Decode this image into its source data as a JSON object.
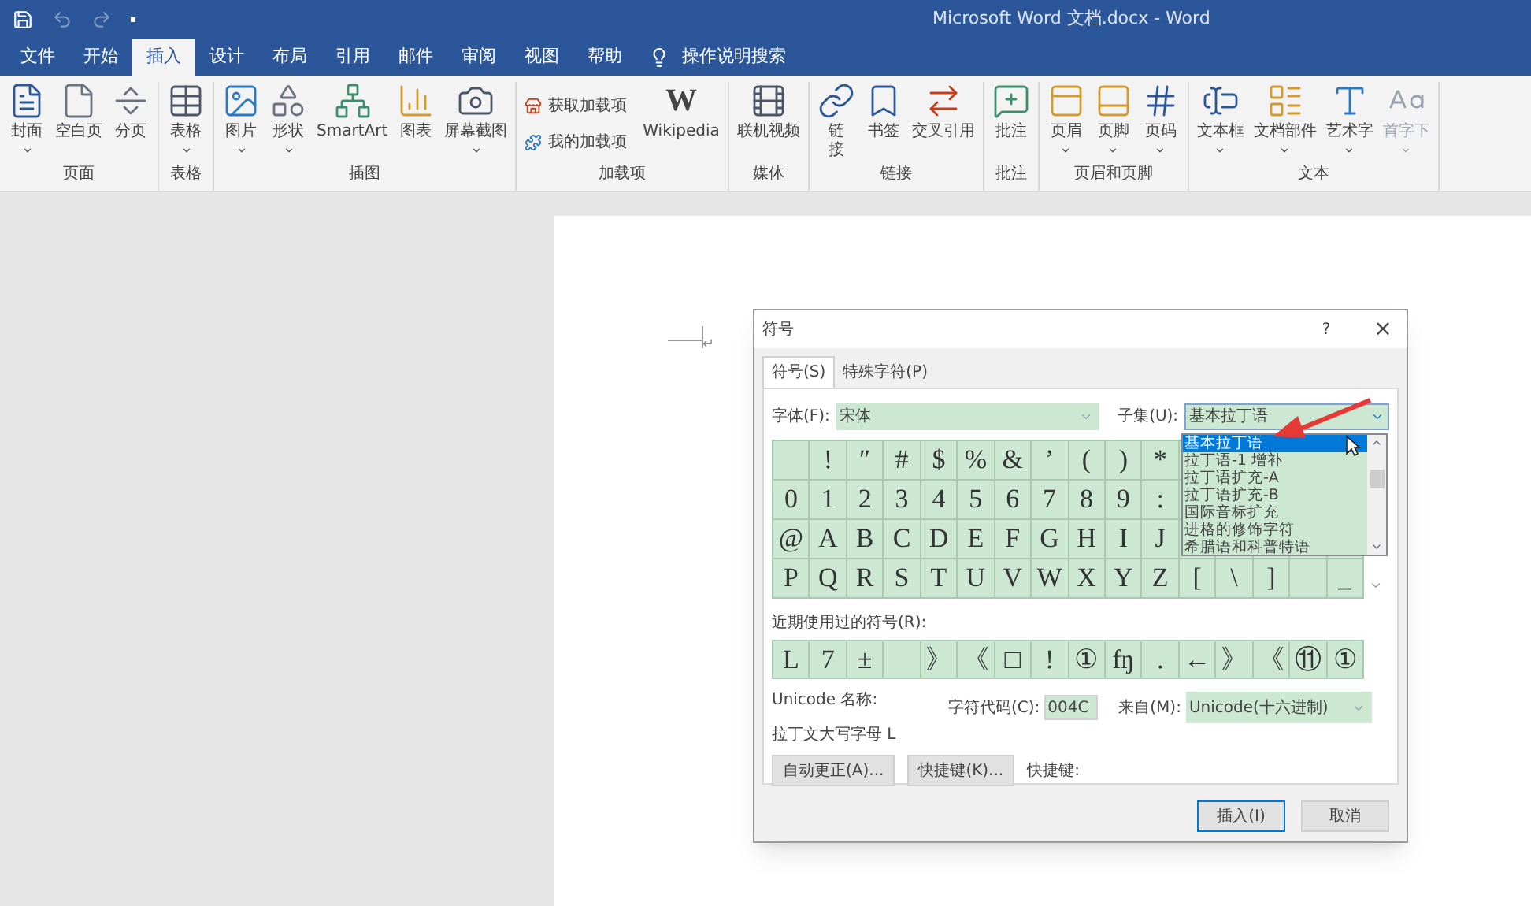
{
  "window": {
    "title": "Microsoft Word 文档.docx  -  Word"
  },
  "ribbon_tabs": [
    {
      "label": "文件",
      "selected": false
    },
    {
      "label": "开始",
      "selected": false
    },
    {
      "label": "插入",
      "selected": true
    },
    {
      "label": "设计",
      "selected": false
    },
    {
      "label": "布局",
      "selected": false
    },
    {
      "label": "引用",
      "selected": false
    },
    {
      "label": "邮件",
      "selected": false
    },
    {
      "label": "审阅",
      "selected": false
    },
    {
      "label": "视图",
      "selected": false
    },
    {
      "label": "帮助",
      "selected": false
    }
  ],
  "tell_me": {
    "label": "操作说明搜索"
  },
  "ribbon_groups": [
    {
      "label": "页面",
      "items": [
        {
          "label": "封面",
          "has_menu": true
        },
        {
          "label": "空白页",
          "has_menu": false
        },
        {
          "label": "分页",
          "has_menu": false
        }
      ]
    },
    {
      "label": "表格",
      "items": [
        {
          "label": "表格",
          "has_menu": true
        }
      ]
    },
    {
      "label": "插图",
      "items": [
        {
          "label": "图片",
          "has_menu": true
        },
        {
          "label": "形状",
          "has_menu": true
        },
        {
          "label": "SmartArt",
          "has_menu": false
        },
        {
          "label": "图表",
          "has_menu": false
        },
        {
          "label": "屏幕截图",
          "has_menu": true
        }
      ]
    },
    {
      "label": "加载项",
      "kind": "addins",
      "small_items": [
        {
          "label": "获取加载项"
        },
        {
          "label": "我的加载项"
        }
      ],
      "items": [
        {
          "label": "Wikipedia",
          "has_menu": false,
          "icon_text": "W"
        }
      ]
    },
    {
      "label": "媒体",
      "items": [
        {
          "label": "联机视频",
          "has_menu": false
        }
      ]
    },
    {
      "label": "链接",
      "items": [
        {
          "label": "链接",
          "has_menu": false
        },
        {
          "label": "书签",
          "has_menu": false
        },
        {
          "label": "交叉引用",
          "has_menu": false
        }
      ]
    },
    {
      "label": "批注",
      "items": [
        {
          "label": "批注",
          "has_menu": false
        }
      ]
    },
    {
      "label": "页眉和页脚",
      "items": [
        {
          "label": "页眉",
          "has_menu": true
        },
        {
          "label": "页脚",
          "has_menu": true
        },
        {
          "label": "页码",
          "has_menu": true
        }
      ]
    },
    {
      "label": "文本",
      "items": [
        {
          "label": "文本框",
          "has_menu": true
        },
        {
          "label": "文档部件",
          "has_menu": true
        },
        {
          "label": "艺术字",
          "has_menu": true
        },
        {
          "label": "首字下",
          "has_menu": true
        }
      ]
    }
  ],
  "document": {
    "paragraph_mark": "↵"
  },
  "dialog": {
    "title": "符号",
    "help": "?",
    "close": "×",
    "tabs": [
      {
        "label": "符号(S)",
        "selected": true
      },
      {
        "label": "特殊字符(P)",
        "selected": false
      }
    ],
    "font": {
      "label": "字体(F):",
      "value": "宋体"
    },
    "subset": {
      "label": "子集(U):",
      "value": "基本拉丁语"
    },
    "symbol_rows": [
      [
        {
          "kind": "blank"
        },
        {
          "kind": "symbol",
          "char": "!"
        },
        {
          "kind": "symbol",
          "char": "″"
        },
        {
          "kind": "symbol",
          "char": "#"
        },
        {
          "kind": "symbol",
          "char": "$"
        },
        {
          "kind": "symbol",
          "char": "%"
        },
        {
          "kind": "symbol",
          "char": "&"
        },
        {
          "kind": "symbol",
          "char": "’"
        },
        {
          "kind": "symbol",
          "char": "("
        },
        {
          "kind": "symbol",
          "char": ")"
        },
        {
          "kind": "symbol",
          "char": "*"
        }
      ],
      [
        {
          "kind": "symbol",
          "char": "0"
        },
        {
          "kind": "symbol",
          "char": "1"
        },
        {
          "kind": "symbol",
          "char": "2"
        },
        {
          "kind": "symbol",
          "char": "3"
        },
        {
          "kind": "symbol",
          "char": "4"
        },
        {
          "kind": "symbol",
          "char": "5"
        },
        {
          "kind": "symbol",
          "char": "6"
        },
        {
          "kind": "symbol",
          "char": "7"
        },
        {
          "kind": "symbol",
          "char": "8"
        },
        {
          "kind": "symbol",
          "char": "9"
        },
        {
          "kind": "symbol",
          "char": ":"
        }
      ],
      [
        {
          "kind": "symbol",
          "char": "@"
        },
        {
          "kind": "symbol",
          "char": "A"
        },
        {
          "kind": "symbol",
          "char": "B"
        },
        {
          "kind": "symbol",
          "char": "C"
        },
        {
          "kind": "symbol",
          "char": "D"
        },
        {
          "kind": "symbol",
          "char": "E"
        },
        {
          "kind": "symbol",
          "char": "F"
        },
        {
          "kind": "symbol",
          "char": "G"
        },
        {
          "kind": "symbol",
          "char": "H"
        },
        {
          "kind": "symbol",
          "char": "I"
        },
        {
          "kind": "symbol",
          "char": "J"
        }
      ],
      [
        {
          "kind": "symbol",
          "char": "P"
        },
        {
          "kind": "symbol",
          "char": "Q"
        },
        {
          "kind": "symbol",
          "char": "R"
        },
        {
          "kind": "symbol",
          "char": "S"
        },
        {
          "kind": "symbol",
          "char": "T"
        },
        {
          "kind": "symbol",
          "char": "U"
        },
        {
          "kind": "symbol",
          "char": "V"
        },
        {
          "kind": "symbol",
          "char": "W"
        },
        {
          "kind": "symbol",
          "char": "X"
        },
        {
          "kind": "symbol",
          "char": "Y"
        },
        {
          "kind": "symbol",
          "char": "Z"
        },
        {
          "kind": "symbol",
          "char": "["
        },
        {
          "kind": "symbol",
          "char": "\\"
        },
        {
          "kind": "symbol",
          "char": "]"
        },
        {
          "kind": "blank"
        },
        {
          "kind": "symbol",
          "char": "_"
        }
      ]
    ],
    "subset_options": [
      {
        "label": "基本拉丁语",
        "selected": true
      },
      {
        "label": "拉丁语-1 增补",
        "selected": false
      },
      {
        "label": "拉丁语扩充-A",
        "selected": false
      },
      {
        "label": "拉丁语扩充-B",
        "selected": false
      },
      {
        "label": "国际音标扩充",
        "selected": false
      },
      {
        "label": "进格的修饰字符",
        "selected": false
      },
      {
        "label": "希腊语和科普特语",
        "selected": false
      }
    ],
    "recent_label": "近期使用过的符号(R):",
    "recent": [
      {
        "kind": "symbol",
        "char": "L"
      },
      {
        "kind": "symbol",
        "char": "7"
      },
      {
        "kind": "symbol",
        "char": "±"
      },
      {
        "kind": "blank"
      },
      {
        "kind": "symbol",
        "char": "》"
      },
      {
        "kind": "symbol",
        "char": "《"
      },
      {
        "kind": "symbol",
        "char": "□"
      },
      {
        "kind": "symbol",
        "char": "!"
      },
      {
        "kind": "symbol",
        "char": "①"
      },
      {
        "kind": "symbol",
        "char": "fŋ"
      },
      {
        "kind": "symbol",
        "char": "."
      },
      {
        "kind": "symbol",
        "char": "←"
      },
      {
        "kind": "symbol",
        "char": "》"
      },
      {
        "kind": "symbol",
        "char": "《"
      },
      {
        "kind": "symbol",
        "char": "⑪"
      },
      {
        "kind": "symbol",
        "char": "①"
      }
    ],
    "unicode_name_label": "Unicode 名称:",
    "unicode_name": "拉丁文大写字母 L",
    "char_code": {
      "label": "字符代码(C):",
      "value": "004C"
    },
    "from": {
      "label": "来自(M):",
      "value": "Unicode(十六进制)"
    },
    "autocorrect_button": "自动更正(A)...",
    "shortcut_button": "快捷键(K)...",
    "shortcut_label": "快捷键:",
    "buttons": [
      {
        "label": "插入(I)",
        "selected": true
      },
      {
        "label": "取消",
        "selected": false
      }
    ]
  }
}
